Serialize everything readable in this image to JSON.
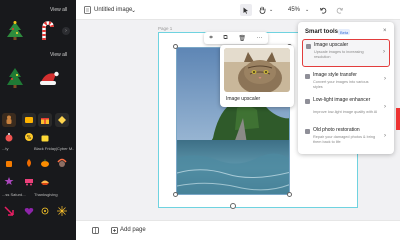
{
  "topbar": {
    "doc_title": "Untitled image",
    "zoom": "45%"
  },
  "sidebar": {
    "view_all_1": "View all",
    "view_all_2": "View all",
    "labels": [
      "...ty",
      "Black Friday|Cyber M...",
      "...ss Saturd...",
      "Thanksgiving"
    ]
  },
  "canvas": {
    "page_label": "Page 1",
    "preview_label": "Image upscaler"
  },
  "smart_tools": {
    "title": "Smart tools",
    "beta": "Beta",
    "tools": [
      {
        "name": "Image upscaler",
        "desc": "Upscale images to increasing resolution"
      },
      {
        "name": "Image style transfer",
        "desc": "Convert your images into various styles"
      },
      {
        "name": "Low-light image enhancer",
        "desc": "Improve low-light image quality with AI"
      },
      {
        "name": "Old photo restoration",
        "desc": "Repair your damaged photos & bring them back to life"
      }
    ]
  },
  "bottombar": {
    "add_page": "Add page"
  },
  "colors": {
    "accent_border": "#e23d3d",
    "selection": "#6fd3e0",
    "sidebar_bg": "#18191c"
  }
}
